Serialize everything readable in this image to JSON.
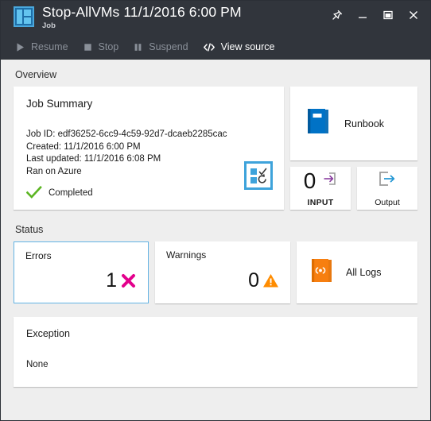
{
  "window": {
    "app_icon": "dashboard-icon",
    "title": "Stop-AllVMs 11/1/2016 6:00 PM",
    "subtitle": "Job",
    "controls": [
      {
        "name": "pin-icon",
        "label": "Pin"
      },
      {
        "name": "minimize-icon",
        "label": "Minimize"
      },
      {
        "name": "maximize-icon",
        "label": "Maximize"
      },
      {
        "name": "close-icon",
        "label": "Close"
      }
    ]
  },
  "toolbar": {
    "resume_label": "Resume",
    "stop_label": "Stop",
    "suspend_label": "Suspend",
    "view_source_label": "View source"
  },
  "overview": {
    "section_label": "Overview",
    "job_summary": {
      "title": "Job Summary",
      "job_id": "Job ID: edf36252-6cc9-4c59-92d7-dcaeb2285cac",
      "created": "Created: 11/1/2016 6:00 PM",
      "last_updated": "Last updated: 11/1/2016 6:08 PM",
      "ran_on": "Ran on Azure",
      "status": "Completed",
      "status_icon": "green-check-icon",
      "badge_icon": "job-checklist-icon"
    },
    "runbook": {
      "label": "Runbook",
      "icon": "blue-book-icon"
    },
    "input": {
      "count": "0",
      "label": "INPUT",
      "icon": "input-arrow-icon"
    },
    "output": {
      "label": "Output",
      "icon": "output-arrow-icon"
    }
  },
  "status": {
    "section_label": "Status",
    "errors": {
      "label": "Errors",
      "count": "1",
      "icon": "error-x-icon",
      "selected": true
    },
    "warnings": {
      "label": "Warnings",
      "count": "0",
      "icon": "warning-triangle-icon"
    },
    "all_logs": {
      "label": "All Logs",
      "icon": "orange-book-icon"
    }
  },
  "exception": {
    "title": "Exception",
    "body": "None"
  },
  "colors": {
    "titlebar": "#31353c",
    "page_background": "#eeeeee",
    "tile_background": "#ffffff",
    "accent_blue": "#0072c6",
    "selected_border": "#63b3e4",
    "error_magenta": "#e3008c",
    "warning_orange": "#ff8c00",
    "success_green": "#5bb522",
    "logs_orange": "#f77f10",
    "input_purple": "#8a3fa0"
  }
}
